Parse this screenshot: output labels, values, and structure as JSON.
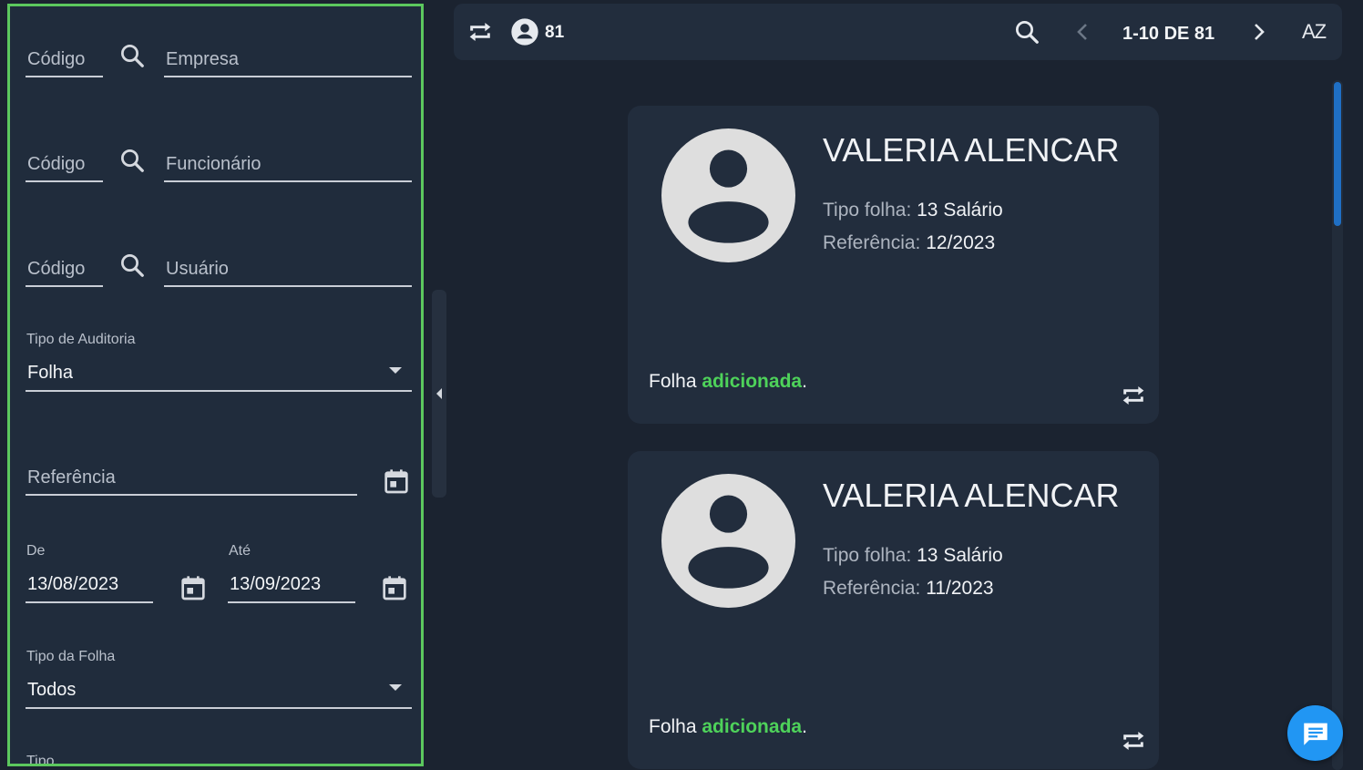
{
  "filters": {
    "empresa": {
      "code_placeholder": "Código",
      "name_placeholder": "Empresa"
    },
    "funcionario": {
      "code_placeholder": "Código",
      "name_placeholder": "Funcionário"
    },
    "usuario": {
      "code_placeholder": "Código",
      "name_placeholder": "Usuário"
    },
    "tipo_auditoria": {
      "label": "Tipo de Auditoria",
      "value": "Folha"
    },
    "referencia": {
      "placeholder": "Referência"
    },
    "de": {
      "label": "De",
      "value": "13/08/2023"
    },
    "ate": {
      "label": "Até",
      "value": "13/09/2023"
    },
    "tipo_folha": {
      "label": "Tipo da Folha",
      "value": "Todos"
    },
    "tipo": {
      "label": "Tipo"
    }
  },
  "toolbar": {
    "count": "81",
    "pagination": "1-10 DE 81",
    "sort_label": "AZ"
  },
  "cards": [
    {
      "name": "VALERIA ALENCAR",
      "tipo_folha_label": "Tipo folha:",
      "tipo_folha_value": "13 Salário",
      "referencia_label": "Referência:",
      "referencia_value": "12/2023",
      "msg_prefix": "Folha",
      "msg_highlight": "adicionada",
      "msg_suffix": "."
    },
    {
      "name": "VALERIA ALENCAR",
      "tipo_folha_label": "Tipo folha:",
      "tipo_folha_value": "13 Salário",
      "referencia_label": "Referência:",
      "referencia_value": "11/2023",
      "msg_prefix": "Folha",
      "msg_highlight": "adicionada",
      "msg_suffix": "."
    }
  ],
  "colors": {
    "accent": "#2196f3",
    "success": "#4ed25a",
    "sidebar_border": "#5cc85e"
  },
  "icons": [
    "search-icon",
    "calendar-icon",
    "dropdown-arrow-icon",
    "swap-icon",
    "user-circle-icon",
    "chevron-left-icon",
    "chevron-right-icon",
    "sort-az-icon",
    "chat-icon"
  ]
}
